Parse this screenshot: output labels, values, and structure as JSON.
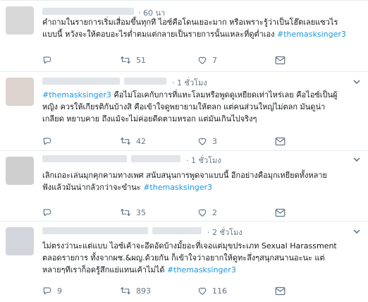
{
  "colors": {
    "hashtag": "#1b95e0",
    "meta": "#657786",
    "divider": "#e6ecf0",
    "avatar": "#d8d8d8"
  },
  "tweets": [
    {
      "time": "60 นา",
      "lines": [
        "คำถามในรายการเริ่มเสื่อมขึ้นทุกที ไอซ์คือโดนเยอะมาก หรือเพราะรู้ว่าเป็นโฮ๊ตเลยแซวไร",
        "แบบนี้ หวังจะให้ตอบอะไรต่ำตมแต่กลายเป็นรายการนั้นแหละที่ดูต่ำเอง"
      ],
      "hashtag": "#themasksinger3",
      "reply_count": "",
      "retweet_count": "51",
      "like_count": "7"
    },
    {
      "time": "1 ชั่วโมง",
      "hashtag": "#themasksinger3",
      "lines": [
        "คือไม่โอเคกับการที่แทะโลมหรือพูดดูเหยียดเท่าไหร่เลย คือไอซ์เป็นผู้",
        "หญิง ควรให้เกียรติกันบ้างสิ คือเข้าใจดูพยายามให้ตลก แต่คนส่วนใหญ่ไม่ตลก มันดูน่า",
        "เกลียด หยาบคาย ถึงแม้จะไม่ค่อยดีดตามหรอก แต่มันเกินไปจริงๆ"
      ],
      "reply_count": "",
      "retweet_count": "42",
      "like_count": "3"
    },
    {
      "time": "1 ชั่วโมง",
      "lines": [
        "เลิกเถอะเล่นมุกคุกคามทางเพศ สนับสนุนการพูดจาแบบนี้ อีกอย่างคือมุกเหยียดทั้งหลาย",
        "ฟังแล้วมันน่ากลัวกว่าจะขำนะ"
      ],
      "hashtag": "#themasksinger3",
      "reply_count": "",
      "retweet_count": "35",
      "like_count": "2"
    },
    {
      "time": "2 ชั่วโมง",
      "lines": [
        "ไม่ตรงว่านะแต่แบบ ไอซ์เค้าจะอึดอัดบ้างมั้ยอะที่เจอแต่มุขประเภท Sexual Harassment",
        "ตลอดรายการ ทั้งจากผช.&ผญ.ด้วยกัน ก็เข้าใจว่าอยากให้ดูทะลึ่งๆสนุกสนานอะนะ แต่",
        "หลายๆทีเราก็อดรู้สึกแย่แทนเค้าไม่ได้"
      ],
      "hashtag": "#themasksinger3",
      "reply_count": "9",
      "retweet_count": "893",
      "like_count": "116"
    }
  ]
}
